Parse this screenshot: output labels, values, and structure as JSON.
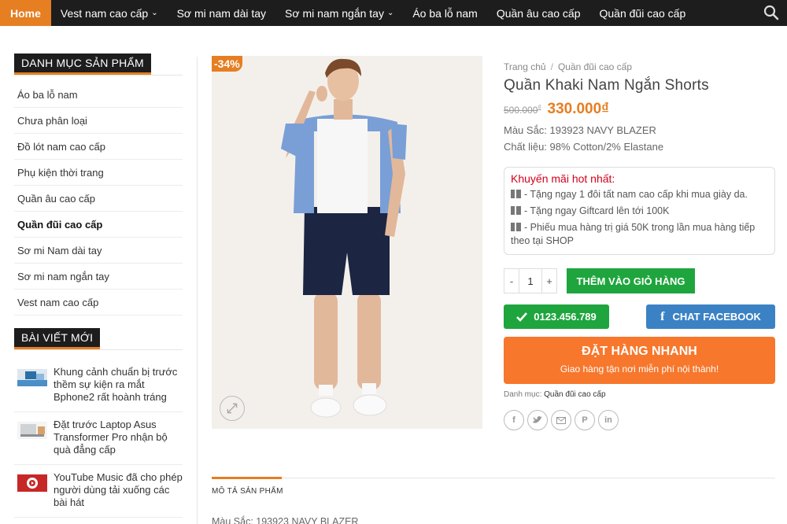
{
  "nav": {
    "items": [
      {
        "label": "Home",
        "active": true,
        "dropdown": false
      },
      {
        "label": "Vest nam cao cấp",
        "active": false,
        "dropdown": true
      },
      {
        "label": "Sơ mi nam dài tay",
        "active": false,
        "dropdown": false
      },
      {
        "label": "Sơ mi nam ngắn tay",
        "active": false,
        "dropdown": true
      },
      {
        "label": "Áo ba lỗ nam",
        "active": false,
        "dropdown": false
      },
      {
        "label": "Quần âu cao cấp",
        "active": false,
        "dropdown": false
      },
      {
        "label": "Quần đũi cao cấp",
        "active": false,
        "dropdown": false
      }
    ],
    "search_icon": "search-icon"
  },
  "sidebar": {
    "categories_title": "DANH MỤC SẢN PHẨM",
    "categories": [
      "Áo ba lỗ nam",
      "Chưa phân loại",
      "Đồ lót nam cao cấp",
      "Phụ kiện thời trang",
      "Quần âu cao cấp",
      "Quần đũi cao cấp",
      "Sơ mi Nam dài tay",
      "Sơ mi nam ngắn tay",
      "Vest nam cao cấp"
    ],
    "current_category": "Quần đũi cao cấp",
    "posts_title": "BÀI VIẾT MỚI",
    "posts": [
      "Khung cảnh chuẩn bị trước thềm sự kiện ra mắt Bphone2 rất hoành tráng",
      "Đặt trước Laptop Asus Transformer Pro nhận bộ quà đẳng cấp",
      "YouTube Music đã cho phép người dùng tải xuống các bài hát"
    ]
  },
  "product": {
    "sale_badge": "-34%",
    "breadcrumb": [
      "Trang chủ",
      "/",
      "Quần đũi cao cấp"
    ],
    "title": "Quần Khaki Nam Ngắn Shorts",
    "old_price": "500.000",
    "old_price_currency": "₫",
    "price": "330.000₫",
    "color_spec": "Màu Sắc: 193923 NAVY BLAZER",
    "material_spec": "Chất liệu: 98% Cotton/2% Elastane",
    "promo_title": "Khuyến mãi hot nhất:",
    "promos": [
      "- Tặng ngay 1 đôi tất nam cao cấp khi mua giày da.",
      "- Tặng ngay Giftcard lên tới 100K",
      "- Phiếu mua hàng trị giá 50K trong lần mua hàng tiếp theo tại SHOP"
    ],
    "qty_minus": "-",
    "qty_value": "1",
    "qty_plus": "+",
    "add_to_cart": "THÊM VÀO GIỎ HÀNG",
    "phone_label": "0123.456.789",
    "fb_label": "CHAT FACEBOOK",
    "order_title": "ĐẶT HÀNG NHANH",
    "order_sub": "Giao hàng tận nơi miễn phí nội thành!",
    "posted_in_label": "Danh mục:",
    "posted_in_value": "Quần đũi cao cấp",
    "share_icons": [
      "facebook-icon",
      "twitter-icon",
      "email-icon",
      "pinterest-icon",
      "linkedin-icon"
    ]
  },
  "tabs": {
    "active_label": "MÔ TẢ SẢN PHẨM",
    "desc_first_line": "Màu Sắc: 193923 NAVY BLAZER"
  },
  "colors": {
    "accent": "#e67e22",
    "green": "#1fa53d",
    "facebook": "#3b82c4",
    "order": "#f7772c",
    "promo_title": "#d0021b",
    "nav_bg": "#1d1d1d"
  }
}
